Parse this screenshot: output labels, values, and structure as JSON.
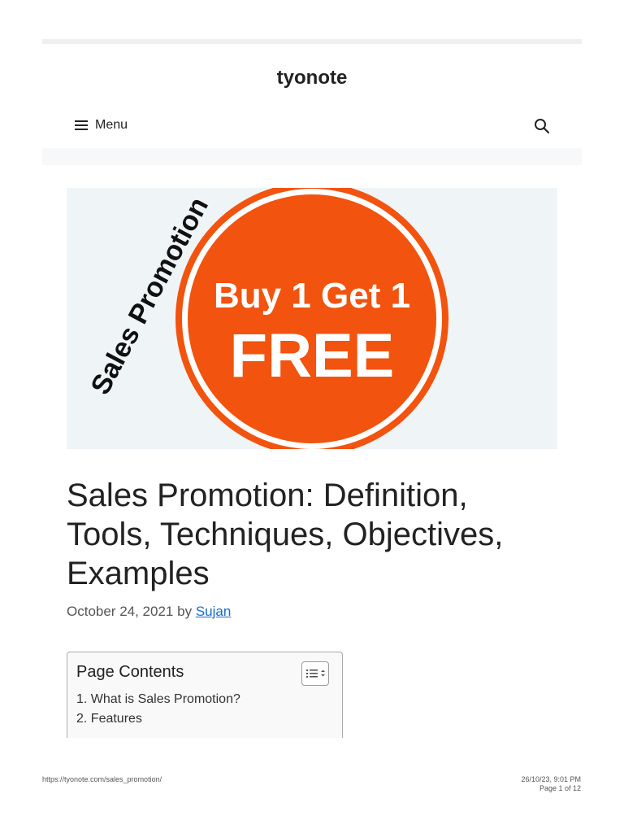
{
  "site": {
    "title": "tyonote"
  },
  "nav": {
    "menu_label": "Menu",
    "menu_icon": "hamburger-icon",
    "search_icon": "search-icon"
  },
  "hero": {
    "side_text": "Sales Promotion",
    "badge_line1": "Buy 1 Get 1",
    "badge_line2": "FREE",
    "badge_color": "#f2530e",
    "background": "#eff4f7"
  },
  "post": {
    "title": "Sales Promotion: Definition, Tools, Techniques, Objectives, Examples",
    "date": "October 24, 2021",
    "by": "by",
    "author": "Sujan"
  },
  "toc": {
    "title": "Page Contents",
    "toggle_icon": "list-toggle-icon",
    "items": [
      "1. What is Sales Promotion?",
      "2. Features"
    ]
  },
  "footer": {
    "url": "https://tyonote.com/sales_promotion/",
    "datetime": "26/10/23, 9:01 PM",
    "page": "Page 1 of 12"
  },
  "colors": {
    "link": "#1b6ac9",
    "text": "#222222"
  }
}
